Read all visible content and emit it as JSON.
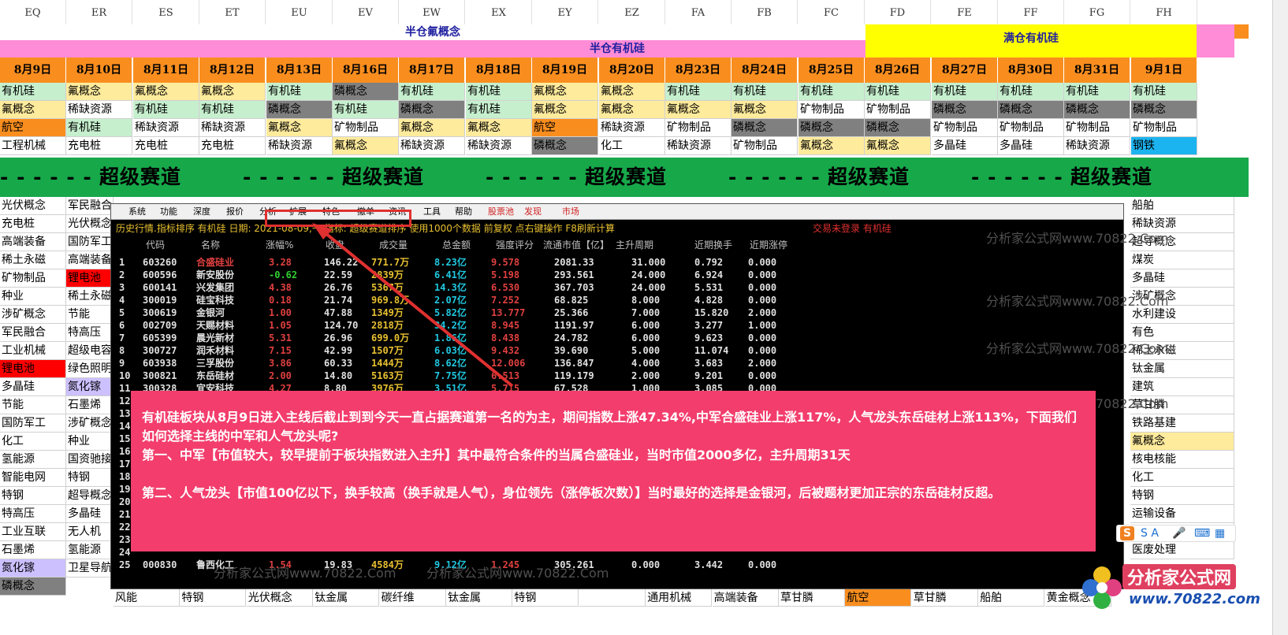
{
  "columns": [
    "EQ",
    "ER",
    "ES",
    "ET",
    "EU",
    "EV",
    "EW",
    "EX",
    "EY",
    "EZ",
    "FA",
    "FB",
    "FC",
    "FD",
    "FE",
    "FF",
    "FG",
    "FH"
  ],
  "banners": {
    "half_fluorine": "半仓氟概念",
    "half_silicon": "半仓有机硅",
    "full_silicon": "满仓有机硅"
  },
  "dates": [
    "8月9日",
    "8月10日",
    "8月11日",
    "8月12日",
    "8月13日",
    "8月16日",
    "8月17日",
    "8月18日",
    "8月19日",
    "8月20日",
    "8月23日",
    "8月24日",
    "8月25日",
    "8月26日",
    "8月27日",
    "8月30日",
    "8月31日",
    "9月1日"
  ],
  "top_rows": [
    [
      "有机硅",
      "氟概念",
      "氟概念",
      "氟概念",
      "有机硅",
      "磷概念",
      "有机硅",
      "有机硅",
      "氟概念",
      "氟概念",
      "有机硅",
      "有机硅",
      "有机硅",
      "有机硅",
      "有机硅",
      "有机硅",
      "有机硅",
      "有机硅"
    ],
    [
      "氟概念",
      "稀缺资源",
      "有机硅",
      "有机硅",
      "磷概念",
      "有机硅",
      "磷概念",
      "有机硅",
      "氟概念",
      "氟概念",
      "氟概念",
      "氟概念",
      "矿物制品",
      "矿物制品",
      "磷概念",
      "磷概念",
      "磷概念",
      "磷概念"
    ],
    [
      "航空",
      "有机硅",
      "稀缺资源",
      "稀缺资源",
      "氟概念",
      "矿物制品",
      "氟概念",
      "氟概念",
      "航空",
      "稀缺资源",
      "矿物制品",
      "磷概念",
      "磷概念",
      "磷概念",
      "矿物制品",
      "矿物制品",
      "矿物制品",
      "矿物制品"
    ],
    [
      "工程机械",
      "充电桩",
      "充电桩",
      "充电桩",
      "稀缺资源",
      "氟概念",
      "稀缺资源",
      "稀缺资源",
      "磷概念",
      "化工",
      "稀缺资源",
      "矿物制品",
      "氟概念",
      "氟概念",
      "多晶硅",
      "多晶硅",
      "稀缺资源",
      "钢铁"
    ]
  ],
  "colors": {
    "silicon": "#c6efce",
    "fluorine": "#ffeb9c",
    "phosphorus": "#808080",
    "orange": "#f98e1f",
    "track_green": "#17a84a",
    "note_pink": "#f33d6c",
    "cyan": "#1cb4f0",
    "red": "#ff0000",
    "lavender": "#ccc0ff"
  },
  "track_text": "超级赛道",
  "left_col_eq": [
    "光伏概念",
    "充电桩",
    "高端装备",
    "稀土永磁",
    "矿物制品",
    "种业",
    "涉矿概念",
    "军民融合",
    "工业机械",
    "锂电池",
    "多晶硅",
    "节能",
    "国防军工",
    "化工",
    "氢能源",
    "智能电网",
    "特钢",
    "特高压",
    "工业互联",
    "石墨烯",
    "氮化镓",
    "磷概念"
  ],
  "left_col_er": [
    "军民融合",
    "光伏概念",
    "国防军工",
    "高端装备",
    "锂电池",
    "稀土永磁",
    "节能",
    "特高压",
    "超级电容",
    "绿色照明",
    "氮化镓",
    "石墨烯",
    "涉矿概念",
    "种业",
    "国资驰接",
    "特钢",
    "超导概念",
    "多晶硅",
    "无人机",
    "氢能源",
    "卫星导航"
  ],
  "right_col_fh": [
    "船舶",
    "稀缺资源",
    "超导概念",
    "煤炭",
    "多晶硅",
    "涉矿概念",
    "水利建设",
    "有色",
    "稀土永磁",
    "钛金属",
    "建筑",
    "草甘膦",
    "铁路基建",
    "氟概念",
    "核电核能",
    "化工",
    "特钢",
    "运输设备",
    "",
    "医废处理"
  ],
  "bottom_row": [
    "风能",
    "特钢",
    "光伏概念",
    "钛金属",
    "碳纤维",
    "钛金属",
    "特钢",
    "",
    "通用机械",
    "高端装备",
    "草甘膦",
    "航空",
    "草甘膦",
    "船舶",
    "黄金概念"
  ],
  "terminal": {
    "menu": [
      "系统",
      "功能",
      "深度",
      "报价",
      "分析",
      "扩展",
      "特色",
      "撤单",
      "资讯",
      "工具",
      "帮助",
      "股票池",
      "发现",
      "市场"
    ],
    "title": "历史行情.指标排序 有机硅 日期: 2021-08-09,一 指标: 超级赛道排序 使用1000个数据 前复权 点右键操作 F8刷新计算",
    "login": "交易未登录 有机硅",
    "headers": [
      "代码",
      "名称",
      "涨幅%",
      "收盘",
      "成交量",
      "总金额",
      "强度评分",
      "流通市值【亿】",
      "主升周期",
      "近期换手",
      "近期涨停"
    ],
    "rows": [
      [
        "1",
        "603260",
        "合盛硅业",
        "3.28",
        "146.22",
        "771.7万",
        "8.23亿",
        "9.578",
        "2081.33",
        "31.000",
        "0.792",
        "0.000"
      ],
      [
        "2",
        "600596",
        "新安股份",
        "-0.62",
        "22.59",
        "2839万",
        "6.41亿",
        "5.198",
        "293.561",
        "24.000",
        "6.924",
        "0.000"
      ],
      [
        "3",
        "600141",
        "兴发集团",
        "4.38",
        "26.76",
        "5367万",
        "14.3亿",
        "6.530",
        "367.703",
        "24.000",
        "5.531",
        "0.000"
      ],
      [
        "4",
        "300019",
        "硅宝科技",
        "0.18",
        "21.74",
        "969.8万",
        "2.07亿",
        "7.252",
        "68.825",
        "8.000",
        "4.828",
        "0.000"
      ],
      [
        "5",
        "300619",
        "金银河",
        "1.00",
        "47.88",
        "1349万",
        "5.82亿",
        "13.777",
        "25.366",
        "7.000",
        "15.820",
        "2.000"
      ],
      [
        "6",
        "002709",
        "天赐材料",
        "1.05",
        "124.70",
        "2818万",
        "34.2亿",
        "8.945",
        "1191.97",
        "6.000",
        "3.277",
        "1.000"
      ],
      [
        "7",
        "605399",
        "晨光新材",
        "5.31",
        "26.96",
        "699.0万",
        "1.86亿",
        "8.438",
        "24.782",
        "6.000",
        "9.623",
        "0.000"
      ],
      [
        "8",
        "300727",
        "润禾材料",
        "7.15",
        "42.99",
        "1507万",
        "6.03亿",
        "9.432",
        "39.690",
        "5.000",
        "11.074",
        "0.000"
      ],
      [
        "9",
        "603938",
        "三孚股份",
        "3.86",
        "60.33",
        "1444万",
        "8.62亿",
        "12.006",
        "136.847",
        "4.000",
        "3.683",
        "2.000"
      ],
      [
        "10",
        "300821",
        "东岳硅材",
        "2.00",
        "14.80",
        "5163万",
        "7.75亿",
        "6.513",
        "119.179",
        "2.000",
        "9.201",
        "0.000"
      ],
      [
        "11",
        "300328",
        "宜安科技",
        "4.27",
        "8.80",
        "3976万",
        "3.51亿",
        "5.715",
        "67.528",
        "1.000",
        "3.085",
        "0.000"
      ],
      [
        "25",
        "000830",
        "鲁西化工",
        "1.54",
        "19.83",
        "4584万",
        "9.12亿",
        "1.245",
        "305.261",
        "0.000",
        "3.442",
        "0.000"
      ]
    ],
    "tags": [
      "有机硅",
      "有机硅",
      "有机硅",
      "有机硅"
    ],
    "watermark": "分析家公式网www.70822.Com"
  },
  "note": {
    "line1": "有机硅板块从8月9日进入主线后截止到到今天一直占据赛道第一名的为主，期间指数上涨47.34%,中军合盛硅业上涨117%，人气龙头东岳硅材上涨113%，下面我们如何选择主线的中军和人气龙头呢?",
    "line2": "第一、中军【市值较大，较早提前于板块指数进入主升】其中最符合条件的当属合盛硅业，当时市值2000多亿，主升周期31天",
    "line3": "第二、人气龙头【市值100亿以下，换手较高（换手就是人气），身位领先（涨停板次数）】当时最好的选择是金银河，后被题材更加正宗的东岳硅材反超。"
  },
  "logo": {
    "name": "分析家公式网",
    "url": "www.70822.com"
  },
  "ime": {
    "label": "S A"
  }
}
